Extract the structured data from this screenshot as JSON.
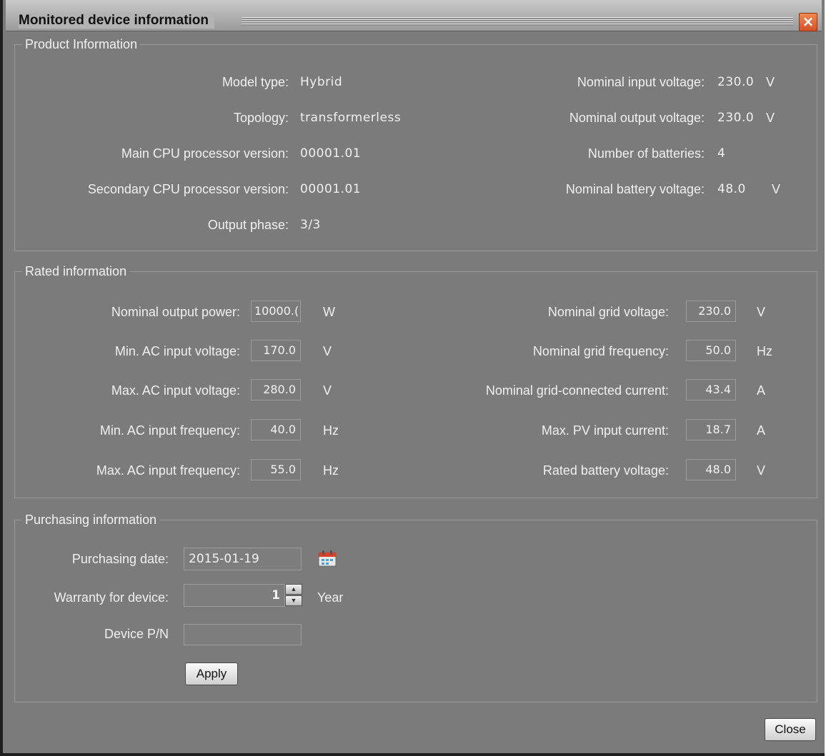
{
  "window": {
    "title": "Monitored device information",
    "close_icon": "close-icon"
  },
  "product": {
    "legend": "Product Information",
    "left": [
      {
        "label": "Model type:",
        "value": "Hybrid"
      },
      {
        "label": "Topology:",
        "value": "transformerless"
      },
      {
        "label": "Main CPU processor version:",
        "value": "00001.01"
      },
      {
        "label": "Secondary CPU processor version:",
        "value": "00001.01"
      },
      {
        "label": "Output phase:",
        "value": "3/3"
      }
    ],
    "right": [
      {
        "label": "Nominal input voltage:",
        "value": "230.0",
        "unit": "V"
      },
      {
        "label": "Nominal output voltage:",
        "value": "230.0",
        "unit": "V"
      },
      {
        "label": "Number of batteries:",
        "value": "4",
        "unit": ""
      },
      {
        "label": "Nominal battery voltage:",
        "value": "48.0",
        "unit": "V"
      }
    ]
  },
  "rated": {
    "legend": "Rated information",
    "left": [
      {
        "label": "Nominal output power:",
        "value": "10000.(",
        "unit": "W"
      },
      {
        "label": "Min. AC input voltage:",
        "value": "170.0",
        "unit": "V"
      },
      {
        "label": "Max. AC input voltage:",
        "value": "280.0",
        "unit": "V"
      },
      {
        "label": "Min. AC input frequency:",
        "value": "40.0",
        "unit": "Hz"
      },
      {
        "label": "Max. AC input frequency:",
        "value": "55.0",
        "unit": "Hz"
      }
    ],
    "right": [
      {
        "label": "Nominal grid voltage:",
        "value": "230.0",
        "unit": "V"
      },
      {
        "label": "Nominal grid frequency:",
        "value": "50.0",
        "unit": "Hz"
      },
      {
        "label": "Nominal grid-connected current:",
        "value": "43.4",
        "unit": "A"
      },
      {
        "label": "Max. PV input current:",
        "value": "18.7",
        "unit": "A"
      },
      {
        "label": "Rated battery voltage:",
        "value": "48.0",
        "unit": "V"
      }
    ]
  },
  "purchasing": {
    "legend": "Purchasing information",
    "date_label": "Purchasing date:",
    "date_value": "2015-01-19",
    "calendar_icon": "calendar-icon",
    "warranty_label": "Warranty for device:",
    "warranty_value": "1",
    "warranty_unit": "Year",
    "pn_label": "Device P/N",
    "pn_value": "",
    "apply_label": "Apply"
  },
  "footer": {
    "close_label": "Close"
  }
}
